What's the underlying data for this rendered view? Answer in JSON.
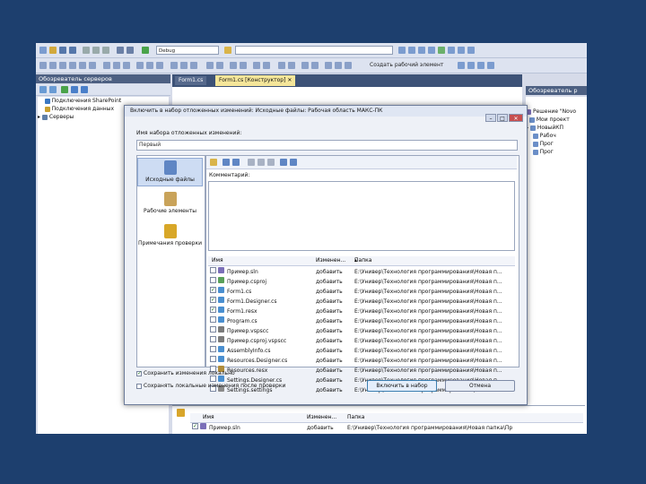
{
  "toolbar": {
    "config_value": "Debug",
    "create_work_item": "Создать рабочий элемент"
  },
  "server_explorer": {
    "title": "Обозреватель серверов",
    "items": [
      "Подключения SharePoint",
      "Подключения данных",
      "Серверы"
    ]
  },
  "editor": {
    "tabs": [
      "Form1.cs",
      "Form1.cs [Конструктор]"
    ]
  },
  "solution_explorer": {
    "title": "Обозреватель р",
    "items": [
      "Решение \"Novo",
      "Мои проект",
      "НовыйКП",
      "Рабоч",
      "Прог",
      "Прог"
    ]
  },
  "dialog": {
    "title": "Включить в набор отложенных изменений: Исходные файлы: Рабочая область МАКС-ПК",
    "name_label": "Имя набора отложенных изменений:",
    "name_value": "Первый",
    "nav": [
      {
        "label": "Исходные файлы",
        "selected": true
      },
      {
        "label": "Рабочие элементы",
        "selected": false
      },
      {
        "label": "Примечания проверки",
        "selected": false
      }
    ],
    "comment_label": "Комментарий:",
    "columns": {
      "name": "Имя",
      "change": "Изменен...",
      "folder": "Папка"
    },
    "files": [
      {
        "checked": false,
        "name": "Пример.sln",
        "change": "добавить",
        "folder": "E:\\Универ\\Технология программирования\\Новая п..."
      },
      {
        "checked": false,
        "name": "Пример.csproj",
        "change": "добавить",
        "folder": "E:\\Универ\\Технология программирования\\Новая п..."
      },
      {
        "checked": true,
        "name": "Form1.cs",
        "change": "добавить",
        "folder": "E:\\Универ\\Технология программирования\\Новая п..."
      },
      {
        "checked": true,
        "name": "Form1.Designer.cs",
        "change": "добавить",
        "folder": "E:\\Универ\\Технология программирования\\Новая п..."
      },
      {
        "checked": true,
        "name": "Form1.resx",
        "change": "добавить",
        "folder": "E:\\Универ\\Технология программирования\\Новая п..."
      },
      {
        "checked": false,
        "name": "Program.cs",
        "change": "добавить",
        "folder": "E:\\Универ\\Технология программирования\\Новая п..."
      },
      {
        "checked": false,
        "name": "Пример.vspscc",
        "change": "добавить",
        "folder": "E:\\Универ\\Технология программирования\\Новая п..."
      },
      {
        "checked": false,
        "name": "Пример.csproj.vspscc",
        "change": "добавить",
        "folder": "E:\\Универ\\Технология программирования\\Новая п..."
      },
      {
        "checked": false,
        "name": "AssemblyInfo.cs",
        "change": "добавить",
        "folder": "E:\\Универ\\Технология программирования\\Новая п..."
      },
      {
        "checked": false,
        "name": "Resources.Designer.cs",
        "change": "добавить",
        "folder": "E:\\Универ\\Технология программирования\\Новая п..."
      },
      {
        "checked": false,
        "name": "Resources.resx",
        "change": "добавить",
        "folder": "E:\\Универ\\Технология программирования\\Новая п..."
      },
      {
        "checked": false,
        "name": "Settings.Designer.cs",
        "change": "добавить",
        "folder": "E:\\Универ\\Технология программирования\\Новая п..."
      },
      {
        "checked": false,
        "name": "Settings.settings",
        "change": "добавить",
        "folder": "E:\\Универ\\Технология программирования\\Новая п..."
      }
    ],
    "option_keep": "Сохранить изменения локально",
    "option_keep_checked": true,
    "option_view": "Сохранять локальные изменения после проверки",
    "option_view_checked": false,
    "btn_ok": "Включить в набор",
    "btn_cancel": "Отмена"
  },
  "bottom_panel": {
    "columns": {
      "name": "Имя",
      "change": "Изменен...",
      "folder": "Папка"
    },
    "row": {
      "checked": true,
      "name": "Пример.sln",
      "change": "добавить",
      "folder": "E:\\Универ\\Технология программирования\\Новая папка\\Пр"
    }
  },
  "colors": {
    "background": "#1d3f6e",
    "accent": "#3c7fb1"
  }
}
